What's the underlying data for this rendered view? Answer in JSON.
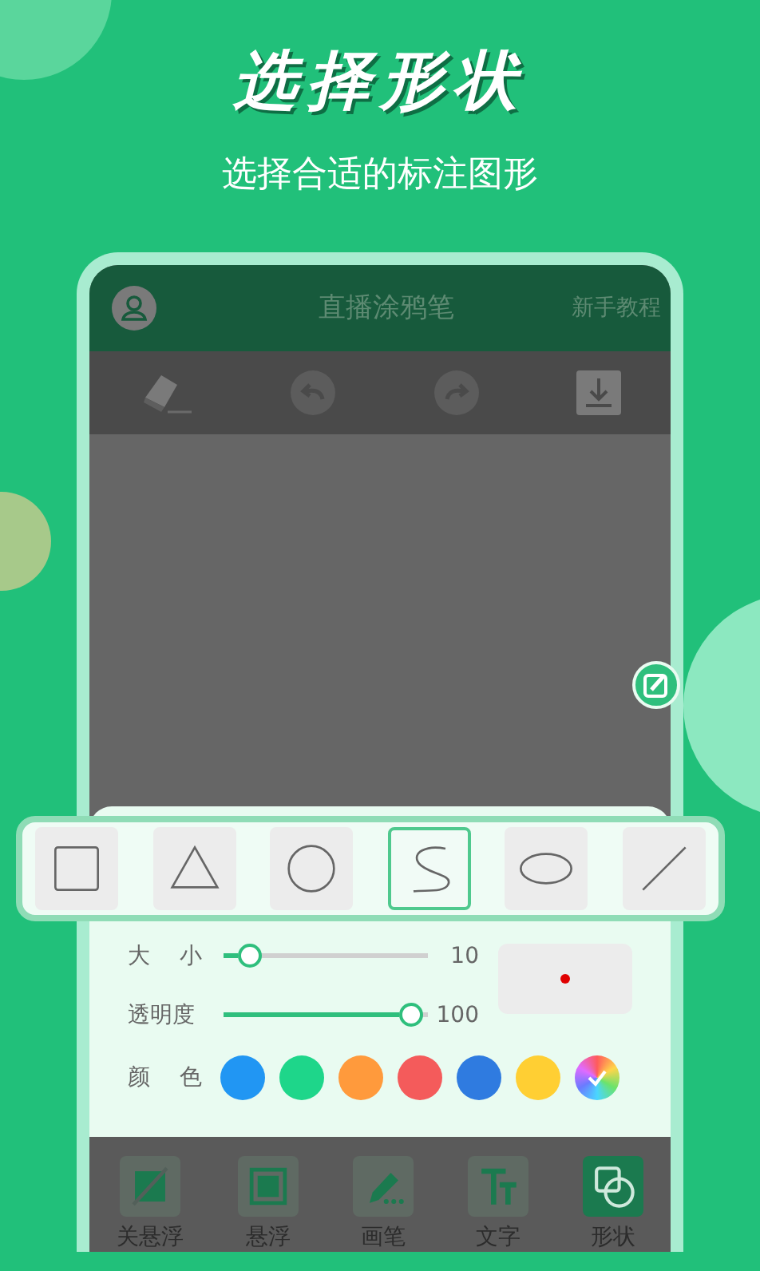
{
  "promo": {
    "title": "选择形状",
    "subtitle": "选择合适的标注图形"
  },
  "app_bar": {
    "title": "直播涂鸦笔",
    "action": "新手教程"
  },
  "shapes": [
    {
      "kind": "square",
      "selected": false
    },
    {
      "kind": "triangle",
      "selected": false
    },
    {
      "kind": "circle",
      "selected": false
    },
    {
      "kind": "curve",
      "selected": true
    },
    {
      "kind": "ellipse",
      "selected": false
    },
    {
      "kind": "line",
      "selected": false
    }
  ],
  "sliders": [
    {
      "label": "大 小",
      "level": 0.08,
      "reading": "10"
    },
    {
      "label": "透明度",
      "level": 0.97,
      "reading": "100"
    }
  ],
  "preview": {
    "color": "#e00000"
  },
  "color_label": "颜 色",
  "colors": [
    {
      "kind": "swatch",
      "color": "#2196f3",
      "selected": false
    },
    {
      "kind": "swatch",
      "color": "#1ed68a",
      "selected": false
    },
    {
      "kind": "swatch",
      "color": "#ff9a3c",
      "selected": false
    },
    {
      "kind": "swatch",
      "color": "#f45b5b",
      "selected": false
    },
    {
      "kind": "swatch",
      "color": "#2f7be0",
      "selected": false
    },
    {
      "kind": "swatch",
      "color": "#ffcf33",
      "selected": false
    },
    {
      "kind": "picker",
      "selected": true
    }
  ],
  "tabs": [
    {
      "kind": "float-off",
      "label": "关悬浮",
      "selected": false
    },
    {
      "kind": "float",
      "label": "悬浮",
      "selected": false
    },
    {
      "kind": "pen",
      "label": "画笔",
      "selected": false
    },
    {
      "kind": "text",
      "label": "文字",
      "selected": false
    },
    {
      "kind": "shape",
      "label": "形状",
      "selected": true
    }
  ]
}
